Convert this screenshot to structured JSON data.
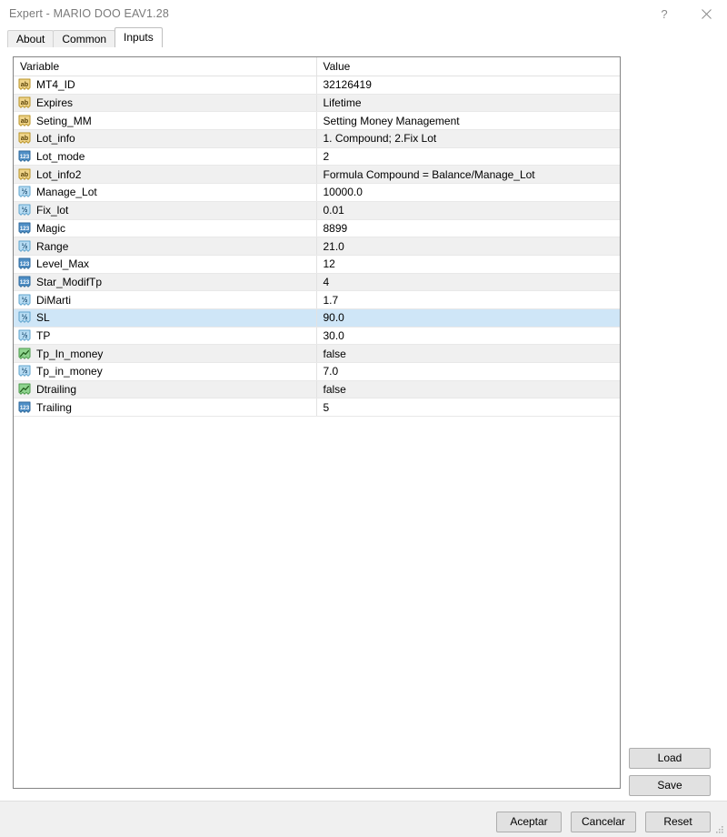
{
  "window": {
    "title": "Expert - MARIO DOO EAV1.28",
    "help_label": "?",
    "close_label": "✕"
  },
  "tabs": [
    {
      "label": "About",
      "active": false
    },
    {
      "label": "Common",
      "active": false
    },
    {
      "label": "Inputs",
      "active": true
    }
  ],
  "table": {
    "headers": {
      "variable": "Variable",
      "value": "Value"
    },
    "rows": [
      {
        "icon": "string-type-icon",
        "variable": "MT4_ID",
        "value": "32126419",
        "selected": false
      },
      {
        "icon": "string-type-icon",
        "variable": "Expires",
        "value": "Lifetime",
        "selected": false
      },
      {
        "icon": "string-type-icon",
        "variable": "Seting_MM",
        "value": "Setting Money Management",
        "selected": false
      },
      {
        "icon": "string-type-icon",
        "variable": "Lot_info",
        "value": "1. Compound; 2.Fix Lot",
        "selected": false
      },
      {
        "icon": "int-type-icon",
        "variable": "Lot_mode",
        "value": "2",
        "selected": false
      },
      {
        "icon": "string-type-icon",
        "variable": "Lot_info2",
        "value": "Formula Compound = Balance/Manage_Lot",
        "selected": false
      },
      {
        "icon": "double-type-icon",
        "variable": "Manage_Lot",
        "value": "10000.0",
        "selected": false
      },
      {
        "icon": "double-type-icon",
        "variable": "Fix_lot",
        "value": "0.01",
        "selected": false
      },
      {
        "icon": "int-type-icon",
        "variable": "Magic",
        "value": "8899",
        "selected": false
      },
      {
        "icon": "double-type-icon",
        "variable": "Range",
        "value": "21.0",
        "selected": false
      },
      {
        "icon": "int-type-icon",
        "variable": "Level_Max",
        "value": "12",
        "selected": false
      },
      {
        "icon": "int-type-icon",
        "variable": "Star_ModifTp",
        "value": "4",
        "selected": false
      },
      {
        "icon": "double-type-icon",
        "variable": "DiMarti",
        "value": "1.7",
        "selected": false
      },
      {
        "icon": "double-type-icon",
        "variable": "SL",
        "value": "90.0",
        "selected": true
      },
      {
        "icon": "double-type-icon",
        "variable": "TP",
        "value": "30.0",
        "selected": false
      },
      {
        "icon": "bool-type-icon",
        "variable": "Tp_In_money",
        "value": "false",
        "selected": false
      },
      {
        "icon": "double-type-icon",
        "variable": "Tp_in_money",
        "value": "7.0",
        "selected": false
      },
      {
        "icon": "bool-type-icon",
        "variable": "Dtrailing",
        "value": "false",
        "selected": false
      },
      {
        "icon": "int-type-icon",
        "variable": "Trailing",
        "value": "5",
        "selected": false
      }
    ]
  },
  "side_buttons": {
    "load_label": "Load",
    "save_label": "Save"
  },
  "footer_buttons": {
    "accept_label": "Aceptar",
    "cancel_label": "Cancelar",
    "reset_label": "Reset"
  },
  "colors": {
    "selection": "#cfe6f7",
    "alt_row": "#f0f0f0",
    "string_icon": "#e8c25a",
    "int_icon": "#5f9fd4",
    "double_icon": "#9fd0ef",
    "bool_icon": "#6fc06f",
    "button_face": "#e1e1e1",
    "footer": "#f0f0f0"
  }
}
